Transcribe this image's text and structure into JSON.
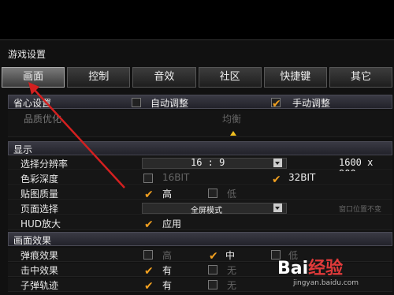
{
  "window": {
    "title": "游戏设置"
  },
  "tabs": [
    "画面",
    "控制",
    "音效",
    "社区",
    "快捷键",
    "其它"
  ],
  "sections": {
    "saver": {
      "label": "省心设置",
      "auto_label": "自动调整",
      "manual_label": "手动调整",
      "quality_label": "品质优化",
      "quality_value": "均衡"
    },
    "display": {
      "label": "显示",
      "resolution_label": "选择分辨率",
      "resolution_aspect": "16 : 9",
      "resolution_value": "1600 x 900",
      "color_depth_label": "色彩深度",
      "color_16": "16BIT",
      "color_32": "32BIT",
      "texture_label": "贴图质量",
      "texture_high": "高",
      "texture_low": "低",
      "page_mode_label": "页面选择",
      "page_mode_value": "全屏模式",
      "window_pos": "窗口位置不变",
      "hud_label": "HUD放大",
      "hud_value": "应用"
    },
    "effects": {
      "label": "画面效果",
      "bullet_mark_label": "弹痕效果",
      "opt_high": "高",
      "opt_mid": "中",
      "opt_low": "低",
      "hit_label": "击中效果",
      "trail_label": "子弹轨迹",
      "opt_yes": "有",
      "opt_no": "无"
    }
  },
  "watermark": {
    "brand_main": "Bai",
    "brand_tail": "经验",
    "sub": "jingyan.baidu.com"
  },
  "colors": {
    "accent_check": "#f1a020",
    "arrow": "#d42020"
  }
}
